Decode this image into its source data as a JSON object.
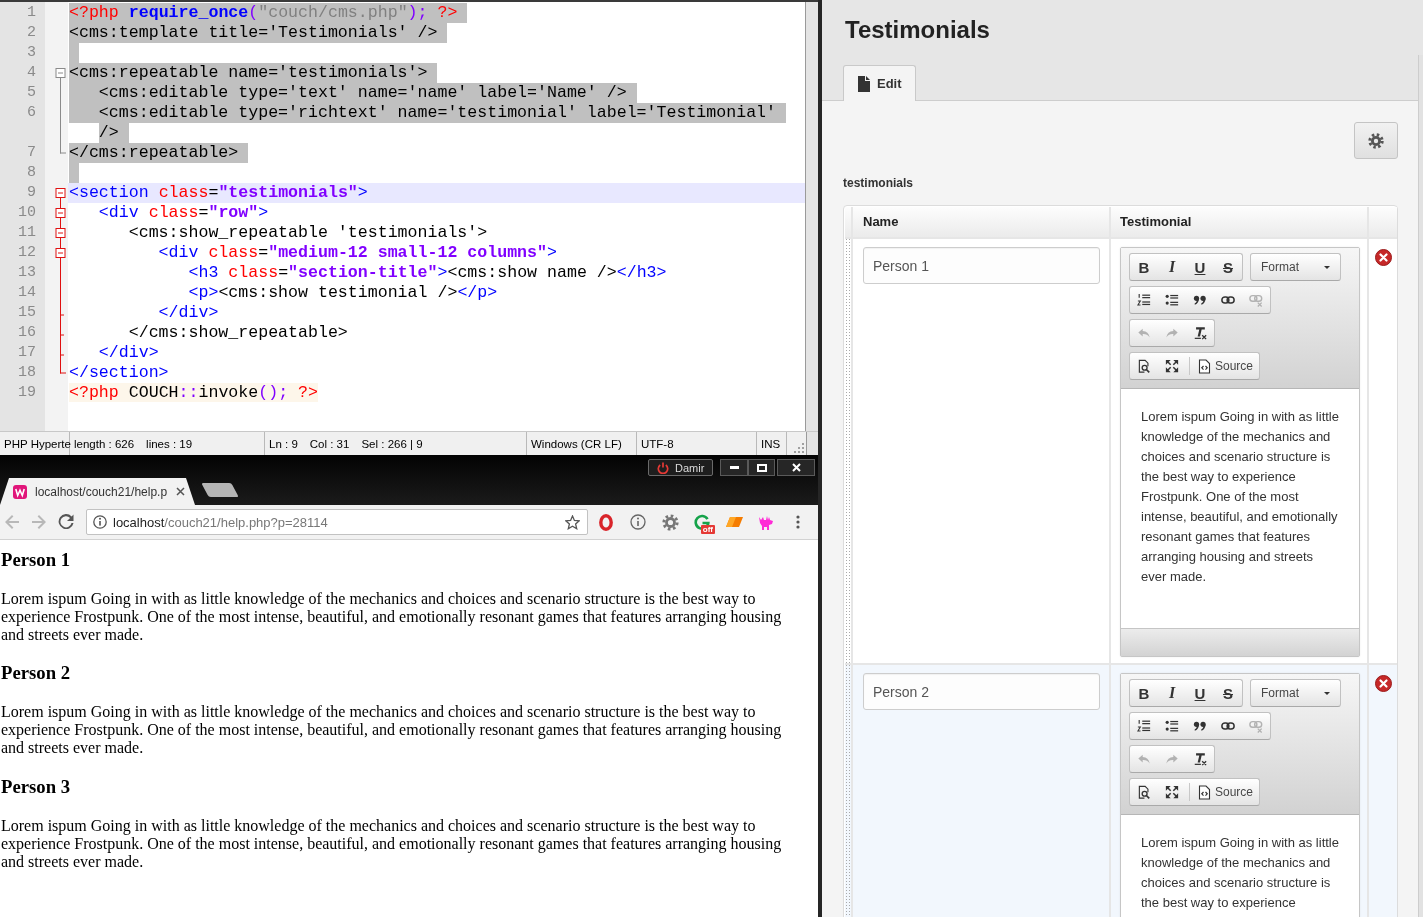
{
  "editor": {
    "lines": [
      {
        "number": "1",
        "selected": true,
        "current": false,
        "tokens": [
          {
            "kind": "php-tag",
            "text": "<?php"
          },
          {
            "kind": "php-keyword",
            "text": " require_once"
          },
          {
            "kind": "php-operator",
            "text": "("
          },
          {
            "kind": "php-string",
            "text": "\"couch/cms.php\""
          },
          {
            "kind": "php-operator",
            "text": ");"
          },
          {
            "kind": "php-tag",
            "text": " ?>"
          }
        ]
      },
      {
        "number": "2",
        "selected": true,
        "current": false,
        "tokens": [
          {
            "kind": "text",
            "text": "<cms:template title='Testimonials' />"
          }
        ]
      },
      {
        "number": "3",
        "selected": true,
        "current": false
      },
      {
        "number": "4",
        "selected": true,
        "current": false,
        "fold": {
          "kind": "start",
          "active": false
        },
        "tokens": [
          {
            "kind": "text",
            "text": "<cms:repeatable name='testimonials'>"
          }
        ]
      },
      {
        "number": "5",
        "selected": true,
        "current": false,
        "fold": {
          "kind": "line",
          "active": false
        },
        "tokens": [
          {
            "kind": "text",
            "text": "   <cms:editable type='text' name='name' label='Name' />"
          }
        ]
      },
      {
        "number": "6",
        "selected": true,
        "current": false,
        "fold": {
          "kind": "line",
          "active": false
        },
        "tokens": [
          {
            "kind": "text",
            "text": "   <cms:editable type='richtext' name='testimonial' label='Testimonial'"
          }
        ],
        "continuation": [
          {
            "kind": "text",
            "text": "/>"
          }
        ]
      },
      {
        "number": "7",
        "selected": true,
        "current": false,
        "fold": {
          "kind": "end",
          "active": false
        },
        "tokens": [
          {
            "kind": "text",
            "text": "</cms:repeatable>"
          }
        ]
      },
      {
        "number": "8",
        "selected": true,
        "current": false
      },
      {
        "number": "9",
        "selected": false,
        "current": true,
        "fold": {
          "kind": "start",
          "active": true
        },
        "tokens": [
          {
            "kind": "tag",
            "text": "<section"
          },
          {
            "kind": "attr",
            "text": " class"
          },
          {
            "kind": "text",
            "text": "="
          },
          {
            "kind": "value",
            "text": "\"testimonials\""
          },
          {
            "kind": "tag",
            "text": ">"
          }
        ]
      },
      {
        "number": "10",
        "selected": false,
        "current": false,
        "fold": {
          "kind": "inner-start",
          "active": true
        },
        "tokens": [
          {
            "kind": "tag",
            "text": "   <div"
          },
          {
            "kind": "attr",
            "text": " class"
          },
          {
            "kind": "text",
            "text": "="
          },
          {
            "kind": "value",
            "text": "\"row\""
          },
          {
            "kind": "tag",
            "text": ">"
          }
        ]
      },
      {
        "number": "11",
        "selected": false,
        "current": false,
        "fold": {
          "kind": "inner-start",
          "active": true
        },
        "tokens": [
          {
            "kind": "text",
            "text": "      <cms:show_repeatable 'testimonials'>"
          }
        ]
      },
      {
        "number": "12",
        "selected": false,
        "current": false,
        "fold": {
          "kind": "inner-start",
          "active": true
        },
        "tokens": [
          {
            "kind": "tag",
            "text": "         <div"
          },
          {
            "kind": "attr",
            "text": " class"
          },
          {
            "kind": "text",
            "text": "="
          },
          {
            "kind": "value",
            "text": "\"medium-12 small-12 columns\""
          },
          {
            "kind": "tag",
            "text": ">"
          }
        ]
      },
      {
        "number": "13",
        "selected": false,
        "current": false,
        "fold": {
          "kind": "line",
          "active": true
        },
        "tokens": [
          {
            "kind": "tag",
            "text": "            <h3"
          },
          {
            "kind": "attr",
            "text": " class"
          },
          {
            "kind": "text",
            "text": "="
          },
          {
            "kind": "value",
            "text": "\"section-title\""
          },
          {
            "kind": "tag",
            "text": ">"
          },
          {
            "kind": "text",
            "text": "<cms:show name />"
          },
          {
            "kind": "tag",
            "text": "</h3>"
          }
        ]
      },
      {
        "number": "14",
        "selected": false,
        "current": false,
        "fold": {
          "kind": "line",
          "active": true
        },
        "tokens": [
          {
            "kind": "tag",
            "text": "            <p>"
          },
          {
            "kind": "text",
            "text": "<cms:show testimonial />"
          },
          {
            "kind": "tag",
            "text": "</p>"
          }
        ]
      },
      {
        "number": "15",
        "selected": false,
        "current": false,
        "fold": {
          "kind": "tick",
          "active": true
        },
        "tokens": [
          {
            "kind": "tag",
            "text": "         </div>"
          }
        ]
      },
      {
        "number": "16",
        "selected": false,
        "current": false,
        "fold": {
          "kind": "tick",
          "active": true
        },
        "tokens": [
          {
            "kind": "text",
            "text": "      </cms:show_repeatable>"
          }
        ]
      },
      {
        "number": "17",
        "selected": false,
        "current": false,
        "fold": {
          "kind": "tick",
          "active": true
        },
        "tokens": [
          {
            "kind": "tag",
            "text": "   </div>"
          }
        ]
      },
      {
        "number": "18",
        "selected": false,
        "current": false,
        "fold": {
          "kind": "end",
          "active": true
        },
        "tokens": [
          {
            "kind": "tag",
            "text": "</section>"
          }
        ]
      },
      {
        "number": "19",
        "selected": false,
        "current": false,
        "tokens": [
          {
            "kind": "php-tag",
            "text": "<?php"
          },
          {
            "kind": "php-text",
            "text": " COUCH"
          },
          {
            "kind": "php-operator",
            "text": "::"
          },
          {
            "kind": "php-text",
            "text": "invoke"
          },
          {
            "kind": "php-operator",
            "text": "();"
          },
          {
            "kind": "php-tag",
            "text": " ?>"
          }
        ]
      }
    ]
  },
  "status_bar": {
    "sections": [
      {
        "items": [
          "PHP Hyperte"
        ]
      },
      {
        "items": [
          "length : 626",
          "lines : 19"
        ]
      },
      {
        "items": [
          "Ln : 9",
          "Col : 31",
          "Sel : 266 | 9"
        ]
      },
      {
        "items": [
          "Windows (CR LF)"
        ]
      },
      {
        "items": [
          "UTF-8"
        ]
      },
      {
        "items": [
          "INS"
        ]
      }
    ]
  },
  "browser": {
    "profile": {
      "name": "Damir"
    },
    "tabs": [
      {
        "title": "localhost/couch21/help.p",
        "selected": true
      }
    ],
    "back": {
      "disabled": true
    },
    "forward": {
      "disabled": true
    },
    "address": {
      "host": "localhost",
      "path": "/couch21/help.php?p=28114"
    },
    "extension_badge": "off",
    "page": {
      "sections": [
        {
          "heading": "Person 1",
          "text": "Lorem ispum Going in with as little knowledge of the mechanics and choices and scenario structure is the best way to experience Frostpunk. One of the most intense, beautiful, and emotionally resonant games that features arranging housing and streets ever made."
        },
        {
          "heading": "Person 2",
          "text": "Lorem ispum Going in with as little knowledge of the mechanics and choices and scenario structure is the best way to experience Frostpunk. One of the most intense, beautiful, and emotionally resonant games that features arranging housing and streets ever made."
        },
        {
          "heading": "Person 3",
          "text": "Lorem ispum Going in with as little knowledge of the mechanics and choices and scenario structure is the best way to experience Frostpunk. One of the most intense, beautiful, and emotionally resonant games that features arranging housing and streets ever made."
        }
      ]
    }
  },
  "admin": {
    "title": "Testimonials",
    "tabs": [
      {
        "label": "Edit",
        "selected": true
      }
    ],
    "field_label": "testimonials",
    "table": {
      "columns": [
        "Name",
        "Testimonial"
      ],
      "rows": [
        {
          "highlighted": false,
          "name": "Person 1",
          "toolbar": {
            "styles": [
              {
                "kind": "bold",
                "label": "B"
              },
              {
                "kind": "italic",
                "label": "I"
              },
              {
                "kind": "underline",
                "label": "U"
              },
              {
                "kind": "strike",
                "label": "S"
              }
            ],
            "format": "Format",
            "tools": [
              {
                "kind": "numbered-list",
                "disabled": false
              },
              {
                "kind": "bulleted-list",
                "disabled": false
              },
              {
                "kind": "blockquote",
                "disabled": false
              },
              {
                "kind": "link",
                "disabled": false
              },
              {
                "kind": "unlink",
                "disabled": true
              }
            ],
            "history": [
              {
                "kind": "undo",
                "disabled": true
              },
              {
                "kind": "redo",
                "disabled": true
              },
              {
                "kind": "remove-format",
                "disabled": false
              }
            ],
            "view": [
              {
                "kind": "preview"
              },
              {
                "kind": "maximize"
              }
            ],
            "source": "Source"
          },
          "testimonial": "Lorem ispum Going in with as little knowledge of the mechanics and choices and scenario structure is the best way to experience Frostpunk. One of the most intense, beautiful, and emotionally resonant games that features arranging housing and streets ever made."
        },
        {
          "highlighted": true,
          "name": "Person 2",
          "toolbar": {
            "styles": [
              {
                "kind": "bold",
                "label": "B"
              },
              {
                "kind": "italic",
                "label": "I"
              },
              {
                "kind": "underline",
                "label": "U"
              },
              {
                "kind": "strike",
                "label": "S"
              }
            ],
            "format": "Format",
            "tools": [
              {
                "kind": "numbered-list",
                "disabled": false
              },
              {
                "kind": "bulleted-list",
                "disabled": false
              },
              {
                "kind": "blockquote",
                "disabled": false
              },
              {
                "kind": "link",
                "disabled": false
              },
              {
                "kind": "unlink",
                "disabled": true
              }
            ],
            "history": [
              {
                "kind": "undo",
                "disabled": true
              },
              {
                "kind": "redo",
                "disabled": true
              },
              {
                "kind": "remove-format",
                "disabled": false
              }
            ],
            "view": [
              {
                "kind": "preview"
              },
              {
                "kind": "maximize"
              }
            ],
            "source": "Source"
          },
          "testimonial": "Lorem ispum Going in with as little knowledge of the mechanics and choices and scenario structure is the best way to experience"
        }
      ]
    }
  }
}
